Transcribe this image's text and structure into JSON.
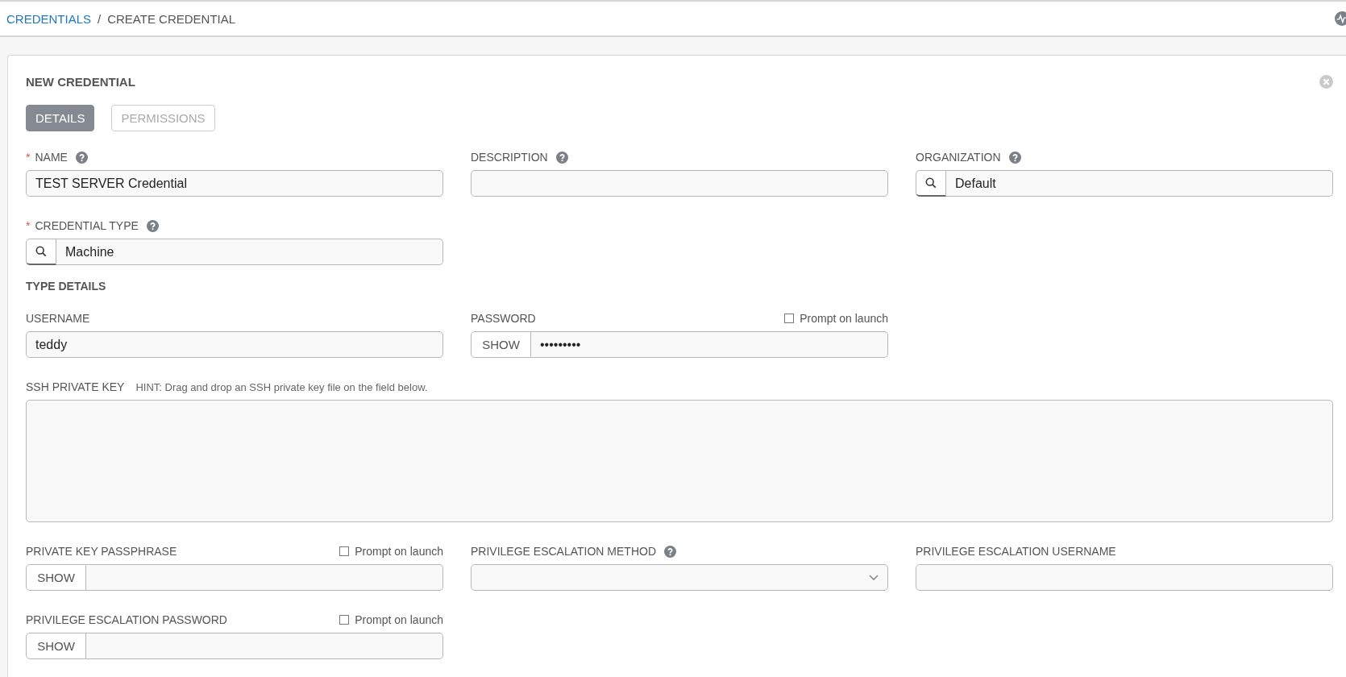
{
  "breadcrumb": {
    "separator": "/",
    "items": [
      {
        "label": "CREDENTIALS",
        "kind": "link"
      },
      {
        "label": "CREATE CREDENTIAL",
        "kind": "current"
      }
    ]
  },
  "card": {
    "title": "NEW CREDENTIAL",
    "required_mark": "*",
    "tabs": [
      {
        "label": "DETAILS",
        "selected": true
      },
      {
        "label": "PERMISSIONS",
        "selected": false
      }
    ],
    "rows": [
      {
        "kind": "fields",
        "fields": [
          {
            "kind": "text",
            "label": "NAME",
            "required": true,
            "help": true,
            "value": "TEST SERVER Credential"
          },
          {
            "kind": "text",
            "label": "DESCRIPTION",
            "required": false,
            "help": true
          },
          {
            "kind": "lookup",
            "label": "ORGANIZATION",
            "required": false,
            "help": true,
            "value": "Default"
          }
        ]
      },
      {
        "kind": "fields",
        "fields": [
          {
            "kind": "lookup",
            "label": "CREDENTIAL TYPE",
            "required": true,
            "help": true,
            "value": "Machine"
          }
        ]
      },
      {
        "kind": "heading",
        "text": "TYPE DETAILS"
      },
      {
        "kind": "fields",
        "fields": [
          {
            "kind": "text",
            "label": "USERNAME",
            "required": false,
            "help": false,
            "value": "teddy"
          },
          {
            "kind": "secret",
            "label": "PASSWORD",
            "required": false,
            "help": false,
            "show_label": "SHOW",
            "value": "•••••••••",
            "prompt": {
              "label": "Prompt on launch",
              "checked": false
            }
          }
        ]
      },
      {
        "kind": "fields",
        "fields": [
          {
            "kind": "textarea",
            "label": "SSH PRIVATE KEY",
            "hint": "HINT: Drag and drop an SSH private key file on the field below.",
            "required": false,
            "help": false
          }
        ]
      },
      {
        "kind": "fields",
        "fields": [
          {
            "kind": "secret",
            "label": "PRIVATE KEY PASSPHRASE",
            "required": false,
            "help": false,
            "show_label": "SHOW",
            "prompt": {
              "label": "Prompt on launch",
              "checked": false
            }
          },
          {
            "kind": "select",
            "label": "PRIVILEGE ESCALATION METHOD",
            "required": false,
            "help": true
          },
          {
            "kind": "text",
            "label": "PRIVILEGE ESCALATION USERNAME",
            "required": false,
            "help": false
          }
        ]
      },
      {
        "kind": "fields",
        "fields": [
          {
            "kind": "secret",
            "label": "PRIVILEGE ESCALATION PASSWORD",
            "required": false,
            "help": false,
            "show_label": "SHOW",
            "prompt": {
              "label": "Prompt on launch",
              "checked": false
            }
          }
        ]
      }
    ]
  }
}
